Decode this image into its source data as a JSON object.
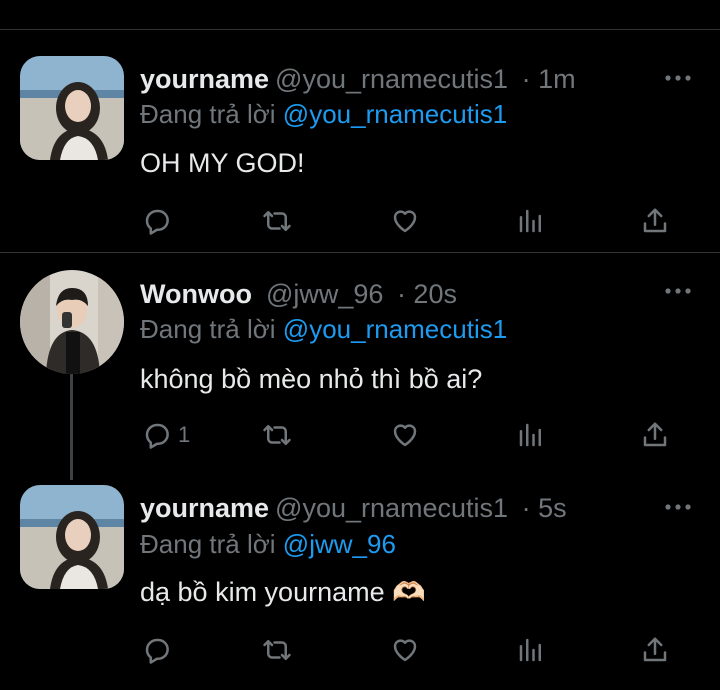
{
  "tweets": [
    {
      "name": "yourname",
      "handle": "@you_rnamecutis1",
      "time": "· 1m",
      "replying_prefix": "Đang trả lời",
      "replying_to": "@you_rnamecutis1",
      "text": "OH MY GOD!",
      "reply_count": ""
    },
    {
      "name": "Wonwoo",
      "handle": "@jww_96",
      "time": "· 20s",
      "replying_prefix": "Đang trả lời",
      "replying_to": "@you_rnamecutis1",
      "text": "không bồ mèo nhỏ thì bồ ai?",
      "reply_count": "1"
    },
    {
      "name": "yourname",
      "handle": "@you_rnamecutis1",
      "time": "· 5s",
      "replying_prefix": "Đang trả lời",
      "replying_to": "@jww_96",
      "text": "dạ bồ kim yourname 🫶🏻",
      "reply_count": ""
    }
  ],
  "icons": {
    "reply": "reply-icon",
    "retweet": "retweet-icon",
    "like": "heart-icon",
    "views": "views-icon",
    "share": "share-icon",
    "more": "more-icon"
  },
  "colors": {
    "background": "#000000",
    "text": "#e7e9ea",
    "muted": "#71767b",
    "accent": "#1d9bf0"
  }
}
